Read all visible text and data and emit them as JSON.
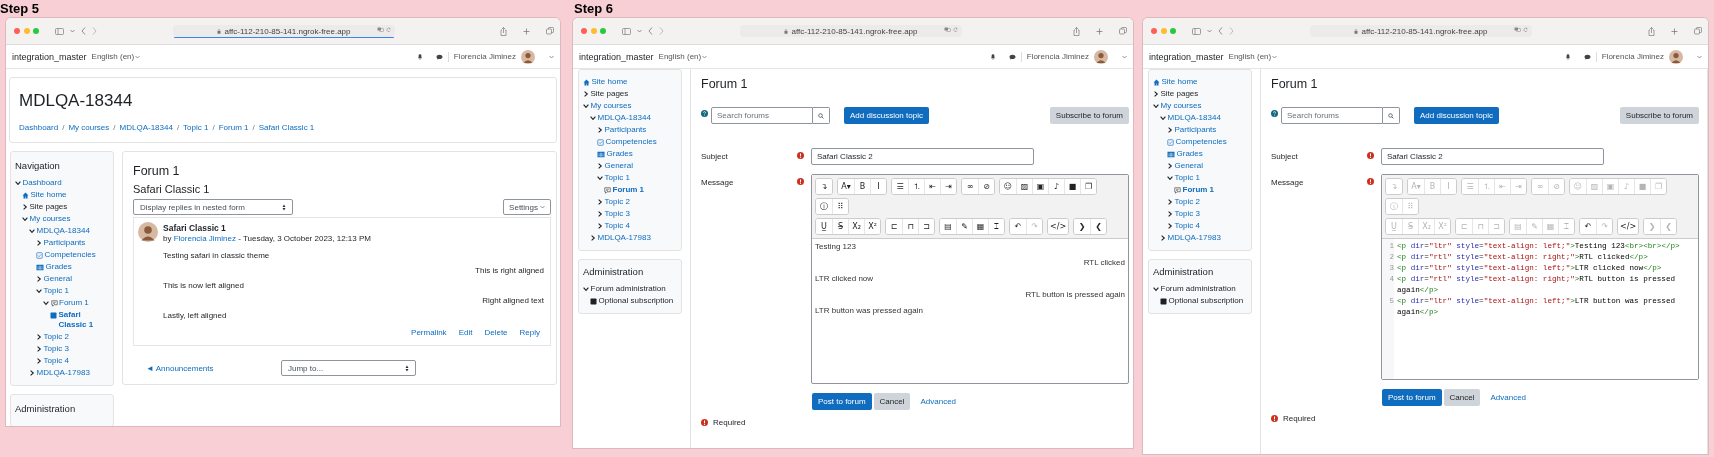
{
  "windows": [
    {
      "step_label": "Step 5",
      "url": "affc-112-210-85-141.ngrok-free.app",
      "loading": true,
      "site_name": "integration_master",
      "language": "English (en)",
      "user_name": "Florencia Jiminez",
      "page_header": {
        "title": "MDLQA-18344",
        "breadcrumbs": [
          "Dashboard",
          "My courses",
          "MDLQA-18344",
          "Topic 1",
          "Forum 1",
          "Safari Classic 1"
        ],
        "separator": "/"
      },
      "navigation": {
        "title": "Navigation",
        "items": [
          {
            "label": "Dashboard",
            "link": true,
            "selected": false,
            "expanded": true,
            "children": [
              {
                "label": "Site home",
                "kind": "home",
                "link": true,
                "selected": false
              },
              {
                "label": "Site pages",
                "link": false,
                "selected": false,
                "expanded": false
              },
              {
                "label": "My courses",
                "link": true,
                "selected": false,
                "expanded": true,
                "children": [
                  {
                    "label": "MDLQA-18344",
                    "link": true,
                    "selected": false,
                    "expanded": true,
                    "children": [
                      {
                        "label": "Participants",
                        "link": true,
                        "selected": false,
                        "expanded": false
                      },
                      {
                        "label": "Competencies",
                        "kind": "checklist",
                        "link": true,
                        "selected": false
                      },
                      {
                        "label": "Grades",
                        "kind": "table",
                        "link": true,
                        "selected": false
                      },
                      {
                        "label": "General",
                        "link": true,
                        "selected": false,
                        "expanded": false
                      },
                      {
                        "label": "Topic 1",
                        "link": true,
                        "selected": false,
                        "expanded": true,
                        "children": [
                          {
                            "label": "Forum 1",
                            "kind": "forum",
                            "link": true,
                            "selected": false,
                            "expanded": true,
                            "children": [
                              {
                                "label": "Safari Classic 1",
                                "kind": "page",
                                "link": true,
                                "selected": true
                              }
                            ]
                          }
                        ]
                      },
                      {
                        "label": "Topic 2",
                        "link": true,
                        "selected": false,
                        "expanded": false
                      },
                      {
                        "label": "Topic 3",
                        "link": true,
                        "selected": false,
                        "expanded": false
                      },
                      {
                        "label": "Topic 4",
                        "link": true,
                        "selected": false,
                        "expanded": false
                      }
                    ]
                  },
                  {
                    "label": "MDLQA-17983",
                    "link": true,
                    "selected": false,
                    "expanded": false
                  }
                ]
              }
            ]
          }
        ]
      },
      "administration": {
        "title": "Administration"
      },
      "main": {
        "kind": "discussion",
        "title": "Forum 1",
        "discussion_title": "Safari Classic 1",
        "display_mode": "Display replies in nested form",
        "settings": "Settings",
        "post": {
          "subject": "Safari Classic 1",
          "by": "by",
          "author": "Florencia Jiminez",
          "date": "- Tuesday, 3 October 2023, 12:13 PM",
          "paragraphs": [
            {
              "text": "Testing safari in classic theme",
              "right_aligned": false
            },
            {
              "text": "This is right aligned",
              "right_aligned": true
            },
            {
              "text": "This is now left aligned",
              "right_aligned": false
            },
            {
              "text": "Right aligned text",
              "right_aligned": true
            },
            {
              "text": "Lastly, left aligned",
              "right_aligned": false
            }
          ],
          "actions": [
            "Permalink",
            "Edit",
            "Delete",
            "Reply"
          ]
        },
        "previous_link": "◄ Announcements",
        "jump_to": "Jump to..."
      }
    },
    {
      "step_label": "Step 6",
      "url": "affc-112-210-85-141.ngrok-free.app",
      "site_name": "integration_master",
      "language": "English (en)",
      "user_name": "Florencia Jiminez",
      "navigation": {
        "items": [
          {
            "label": "Site home",
            "kind": "home",
            "link": true,
            "selected": false
          },
          {
            "label": "Site pages",
            "link": false,
            "selected": false,
            "expanded": false
          },
          {
            "label": "My courses",
            "link": true,
            "selected": false,
            "expanded": true,
            "children": [
              {
                "label": "MDLQA-18344",
                "link": true,
                "selected": false,
                "expanded": true,
                "children": [
                  {
                    "label": "Participants",
                    "link": true,
                    "selected": false,
                    "expanded": false
                  },
                  {
                    "label": "Competencies",
                    "kind": "checklist",
                    "link": true,
                    "selected": false
                  },
                  {
                    "label": "Grades",
                    "kind": "table",
                    "link": true,
                    "selected": false
                  },
                  {
                    "label": "General",
                    "link": true,
                    "selected": false,
                    "expanded": false
                  },
                  {
                    "label": "Topic 1",
                    "link": true,
                    "selected": false,
                    "expanded": true,
                    "children": [
                      {
                        "label": "Forum 1",
                        "kind": "forum",
                        "link": true,
                        "selected": true
                      }
                    ]
                  },
                  {
                    "label": "Topic 2",
                    "link": true,
                    "selected": false,
                    "expanded": false
                  },
                  {
                    "label": "Topic 3",
                    "link": true,
                    "selected": false,
                    "expanded": false
                  },
                  {
                    "label": "Topic 4",
                    "link": true,
                    "selected": false,
                    "expanded": false
                  }
                ]
              },
              {
                "label": "MDLQA-17983",
                "link": true,
                "selected": false,
                "expanded": false
              }
            ]
          }
        ]
      },
      "administration": {
        "title": "Administration",
        "items": [
          {
            "label": "Forum administration",
            "link": false,
            "selected": false,
            "expanded": true,
            "children": [
              {
                "label": "Optional subscription",
                "kind": "page",
                "link": false,
                "selected": false
              }
            ]
          }
        ]
      },
      "main": {
        "kind": "post_form",
        "title": "Forum 1",
        "search_placeholder": "Search forums",
        "add_button": "Add discussion topic",
        "subscribe_button": "Subscribe to forum",
        "subject_label": "Subject",
        "subject_value": "Safari Classic 2",
        "message_label": "Message",
        "editor": {
          "kind": "wysiwyg",
          "toolbar": [
            {
              "groups": [
                {
                  "buttons": [
                    {
                      "glyph": "↴",
                      "disabled": false
                    }
                  ]
                },
                {
                  "buttons": [
                    {
                      "glyph": "A▾",
                      "disabled": false
                    },
                    {
                      "glyph": "B",
                      "disabled": false
                    },
                    {
                      "glyph": "I",
                      "disabled": false
                    }
                  ]
                },
                {
                  "buttons": [
                    {
                      "glyph": "☰",
                      "disabled": false
                    },
                    {
                      "glyph": "⒈",
                      "disabled": false
                    },
                    {
                      "glyph": "⇤",
                      "disabled": false
                    },
                    {
                      "glyph": "⇥",
                      "disabled": false
                    }
                  ]
                },
                {
                  "buttons": [
                    {
                      "glyph": "∞",
                      "disabled": false
                    },
                    {
                      "glyph": "⊘",
                      "disabled": false
                    }
                  ]
                },
                {
                  "buttons": [
                    {
                      "glyph": "☺",
                      "disabled": false
                    },
                    {
                      "glyph": "▨",
                      "disabled": false
                    },
                    {
                      "glyph": "▣",
                      "disabled": false
                    },
                    {
                      "glyph": "♪",
                      "disabled": false
                    },
                    {
                      "glyph": "■",
                      "disabled": false
                    },
                    {
                      "glyph": "❐",
                      "disabled": false
                    }
                  ]
                }
              ]
            },
            {
              "groups": [
                {
                  "buttons": [
                    {
                      "glyph": "ⓘ",
                      "disabled": false
                    },
                    {
                      "glyph": "⠿",
                      "disabled": false
                    }
                  ]
                }
              ]
            },
            {
              "groups": [
                {
                  "buttons": [
                    {
                      "glyph": "U̲",
                      "disabled": false
                    },
                    {
                      "glyph": "S̶",
                      "disabled": false
                    },
                    {
                      "glyph": "X₂",
                      "disabled": false
                    },
                    {
                      "glyph": "X²",
                      "disabled": false
                    }
                  ]
                },
                {
                  "buttons": [
                    {
                      "glyph": "⊏",
                      "disabled": false
                    },
                    {
                      "glyph": "⊓",
                      "disabled": false
                    },
                    {
                      "glyph": "⊐",
                      "disabled": false
                    }
                  ]
                },
                {
                  "buttons": [
                    {
                      "glyph": "▤",
                      "disabled": false
                    },
                    {
                      "glyph": "✎",
                      "disabled": false
                    },
                    {
                      "glyph": "▦",
                      "disabled": false
                    },
                    {
                      "glyph": "⌶",
                      "disabled": false
                    }
                  ]
                },
                {
                  "buttons": [
                    {
                      "glyph": "↶",
                      "disabled": false
                    },
                    {
                      "glyph": "↷",
                      "disabled": true
                    }
                  ]
                },
                {
                  "buttons": [
                    {
                      "glyph": "</>",
                      "disabled": false
                    }
                  ]
                },
                {
                  "buttons": [
                    {
                      "glyph": "❯",
                      "disabled": false
                    },
                    {
                      "glyph": "❮",
                      "disabled": false
                    }
                  ]
                }
              ]
            }
          ],
          "paragraphs": [
            {
              "text": "Testing 123",
              "right_aligned": false
            },
            {
              "text": "RTL clicked",
              "right_aligned": true
            },
            {
              "text": "LTR clicked now",
              "right_aligned": false
            },
            {
              "text": "RTL button is pressed again",
              "right_aligned": true
            },
            {
              "text": "LTR button was pressed again",
              "right_aligned": false
            }
          ]
        },
        "submit_button": "Post to forum",
        "cancel_button": "Cancel",
        "advanced_link": "Advanced",
        "required_note": "Required"
      }
    },
    {
      "url": "affc-112-210-85-141.ngrok-free.app",
      "site_name": "integration_master",
      "language": "English (en)",
      "user_name": "Florencia Jiminez",
      "navigation": {
        "items": [
          {
            "label": "Site home",
            "kind": "home",
            "link": true,
            "selected": false
          },
          {
            "label": "Site pages",
            "link": false,
            "selected": false,
            "expanded": false
          },
          {
            "label": "My courses",
            "link": true,
            "selected": false,
            "expanded": true,
            "children": [
              {
                "label": "MDLQA-18344",
                "link": true,
                "selected": false,
                "expanded": true,
                "children": [
                  {
                    "label": "Participants",
                    "link": true,
                    "selected": false,
                    "expanded": false
                  },
                  {
                    "label": "Competencies",
                    "kind": "checklist",
                    "link": true,
                    "selected": false
                  },
                  {
                    "label": "Grades",
                    "kind": "table",
                    "link": true,
                    "selected": false
                  },
                  {
                    "label": "General",
                    "link": true,
                    "selected": false,
                    "expanded": false
                  },
                  {
                    "label": "Topic 1",
                    "link": true,
                    "selected": false,
                    "expanded": true,
                    "children": [
                      {
                        "label": "Forum 1",
                        "kind": "forum",
                        "link": true,
                        "selected": true
                      }
                    ]
                  },
                  {
                    "label": "Topic 2",
                    "link": true,
                    "selected": false,
                    "expanded": false
                  },
                  {
                    "label": "Topic 3",
                    "link": true,
                    "selected": false,
                    "expanded": false
                  },
                  {
                    "label": "Topic 4",
                    "link": true,
                    "selected": false,
                    "expanded": false
                  }
                ]
              },
              {
                "label": "MDLQA-17983",
                "link": true,
                "selected": false,
                "expanded": false
              }
            ]
          }
        ]
      },
      "administration": {
        "title": "Administration",
        "items": [
          {
            "label": "Forum administration",
            "link": false,
            "selected": false,
            "expanded": true,
            "children": [
              {
                "label": "Optional subscription",
                "kind": "page",
                "link": false,
                "selected": false
              }
            ]
          }
        ]
      },
      "main": {
        "kind": "post_form",
        "title": "Forum 1",
        "search_placeholder": "Search forums",
        "add_button": "Add discussion topic",
        "subscribe_button": "Subscribe to forum",
        "subject_label": "Subject",
        "subject_value": "Safari Classic 2",
        "message_label": "Message",
        "editor": {
          "kind": "source",
          "toolbar": [
            {
              "groups": [
                {
                  "buttons": [
                    {
                      "glyph": "↴",
                      "disabled": true
                    }
                  ]
                },
                {
                  "buttons": [
                    {
                      "glyph": "A▾",
                      "disabled": true
                    },
                    {
                      "glyph": "B",
                      "disabled": true
                    },
                    {
                      "glyph": "I",
                      "disabled": true
                    }
                  ]
                },
                {
                  "buttons": [
                    {
                      "glyph": "☰",
                      "disabled": true
                    },
                    {
                      "glyph": "⒈",
                      "disabled": true
                    },
                    {
                      "glyph": "⇤",
                      "disabled": true
                    },
                    {
                      "glyph": "⇥",
                      "disabled": true
                    }
                  ]
                },
                {
                  "buttons": [
                    {
                      "glyph": "∞",
                      "disabled": true
                    },
                    {
                      "glyph": "⊘",
                      "disabled": true
                    }
                  ]
                },
                {
                  "buttons": [
                    {
                      "glyph": "☺",
                      "disabled": true
                    },
                    {
                      "glyph": "▨",
                      "disabled": true
                    },
                    {
                      "glyph": "▣",
                      "disabled": true
                    },
                    {
                      "glyph": "♪",
                      "disabled": true
                    },
                    {
                      "glyph": "■",
                      "disabled": true
                    },
                    {
                      "glyph": "❐",
                      "disabled": true
                    }
                  ]
                }
              ]
            },
            {
              "groups": [
                {
                  "buttons": [
                    {
                      "glyph": "ⓘ",
                      "disabled": true
                    },
                    {
                      "glyph": "⠿",
                      "disabled": true
                    }
                  ]
                }
              ]
            },
            {
              "groups": [
                {
                  "buttons": [
                    {
                      "glyph": "U̲",
                      "disabled": true
                    },
                    {
                      "glyph": "S̶",
                      "disabled": true
                    },
                    {
                      "glyph": "X₂",
                      "disabled": true
                    },
                    {
                      "glyph": "X²",
                      "disabled": true
                    }
                  ]
                },
                {
                  "buttons": [
                    {
                      "glyph": "⊏",
                      "disabled": true
                    },
                    {
                      "glyph": "⊓",
                      "disabled": true
                    },
                    {
                      "glyph": "⊐",
                      "disabled": true
                    }
                  ]
                },
                {
                  "buttons": [
                    {
                      "glyph": "▤",
                      "disabled": true
                    },
                    {
                      "glyph": "✎",
                      "disabled": true
                    },
                    {
                      "glyph": "▦",
                      "disabled": true
                    },
                    {
                      "glyph": "⌶",
                      "disabled": true
                    }
                  ]
                },
                {
                  "buttons": [
                    {
                      "glyph": "↶",
                      "disabled": false
                    },
                    {
                      "glyph": "↷",
                      "disabled": true
                    }
                  ]
                },
                {
                  "buttons": [
                    {
                      "glyph": "</>",
                      "disabled": false
                    }
                  ]
                },
                {
                  "buttons": [
                    {
                      "glyph": "❯",
                      "disabled": true
                    },
                    {
                      "glyph": "❮",
                      "disabled": true
                    }
                  ]
                }
              ]
            }
          ],
          "lines": [
            {
              "number": "1",
              "tokens": [
                {
                  "kind": "tag",
                  "text": "<p"
                },
                {
                  "kind": "attr",
                  "text": " dir"
                },
                {
                  "kind": "punct",
                  "text": "="
                },
                {
                  "kind": "value",
                  "text": "\"ltr\""
                },
                {
                  "kind": "attr",
                  "text": " style"
                },
                {
                  "kind": "punct",
                  "text": "="
                },
                {
                  "kind": "value",
                  "text": "\"text-align: left;\""
                },
                {
                  "kind": "tag",
                  "text": ">"
                },
                {
                  "kind": "text",
                  "text": "Testing 123"
                },
                {
                  "kind": "tag",
                  "text": "<br>"
                },
                {
                  "kind": "tag",
                  "text": "<br>"
                },
                {
                  "kind": "tag",
                  "text": "</p>"
                }
              ]
            },
            {
              "number": "2",
              "tokens": [
                {
                  "kind": "tag",
                  "text": "<p"
                },
                {
                  "kind": "attr",
                  "text": " dir"
                },
                {
                  "kind": "punct",
                  "text": "="
                },
                {
                  "kind": "value",
                  "text": "\"rtl\""
                },
                {
                  "kind": "attr",
                  "text": " style"
                },
                {
                  "kind": "punct",
                  "text": "="
                },
                {
                  "kind": "value",
                  "text": "\"text-align: right;\""
                },
                {
                  "kind": "tag",
                  "text": ">"
                },
                {
                  "kind": "text",
                  "text": "RTL clicked"
                },
                {
                  "kind": "tag",
                  "text": "</p>"
                }
              ]
            },
            {
              "number": "3",
              "tokens": [
                {
                  "kind": "tag",
                  "text": "<p"
                },
                {
                  "kind": "attr",
                  "text": " dir"
                },
                {
                  "kind": "punct",
                  "text": "="
                },
                {
                  "kind": "value",
                  "text": "\"ltr\""
                },
                {
                  "kind": "attr",
                  "text": " style"
                },
                {
                  "kind": "punct",
                  "text": "="
                },
                {
                  "kind": "value",
                  "text": "\"text-align: left;\""
                },
                {
                  "kind": "tag",
                  "text": ">"
                },
                {
                  "kind": "text",
                  "text": "LTR clicked now"
                },
                {
                  "kind": "tag",
                  "text": "</p>"
                }
              ]
            },
            {
              "number": "4",
              "tokens": [
                {
                  "kind": "tag",
                  "text": "<p"
                },
                {
                  "kind": "attr",
                  "text": " dir"
                },
                {
                  "kind": "punct",
                  "text": "="
                },
                {
                  "kind": "value",
                  "text": "\"rtl\""
                },
                {
                  "kind": "attr",
                  "text": " style"
                },
                {
                  "kind": "punct",
                  "text": "="
                },
                {
                  "kind": "value",
                  "text": "\"text-align: right;\""
                },
                {
                  "kind": "tag",
                  "text": ">"
                },
                {
                  "kind": "text",
                  "text": "RTL button is pressed again"
                },
                {
                  "kind": "tag",
                  "text": "</p>"
                }
              ]
            },
            {
              "number": "5",
              "tokens": [
                {
                  "kind": "tag",
                  "text": "<p"
                },
                {
                  "kind": "attr",
                  "text": " dir"
                },
                {
                  "kind": "punct",
                  "text": "="
                },
                {
                  "kind": "value",
                  "text": "\"ltr\""
                },
                {
                  "kind": "attr",
                  "text": " style"
                },
                {
                  "kind": "punct",
                  "text": "="
                },
                {
                  "kind": "value",
                  "text": "\"text-align: left;\""
                },
                {
                  "kind": "tag",
                  "text": ">"
                },
                {
                  "kind": "text",
                  "text": "LTR button was pressed again"
                },
                {
                  "kind": "tag",
                  "text": "</p>"
                }
              ]
            }
          ]
        },
        "submit_button": "Post to forum",
        "cancel_button": "Cancel",
        "advanced_link": "Advanced",
        "required_note": "Required"
      }
    }
  ]
}
